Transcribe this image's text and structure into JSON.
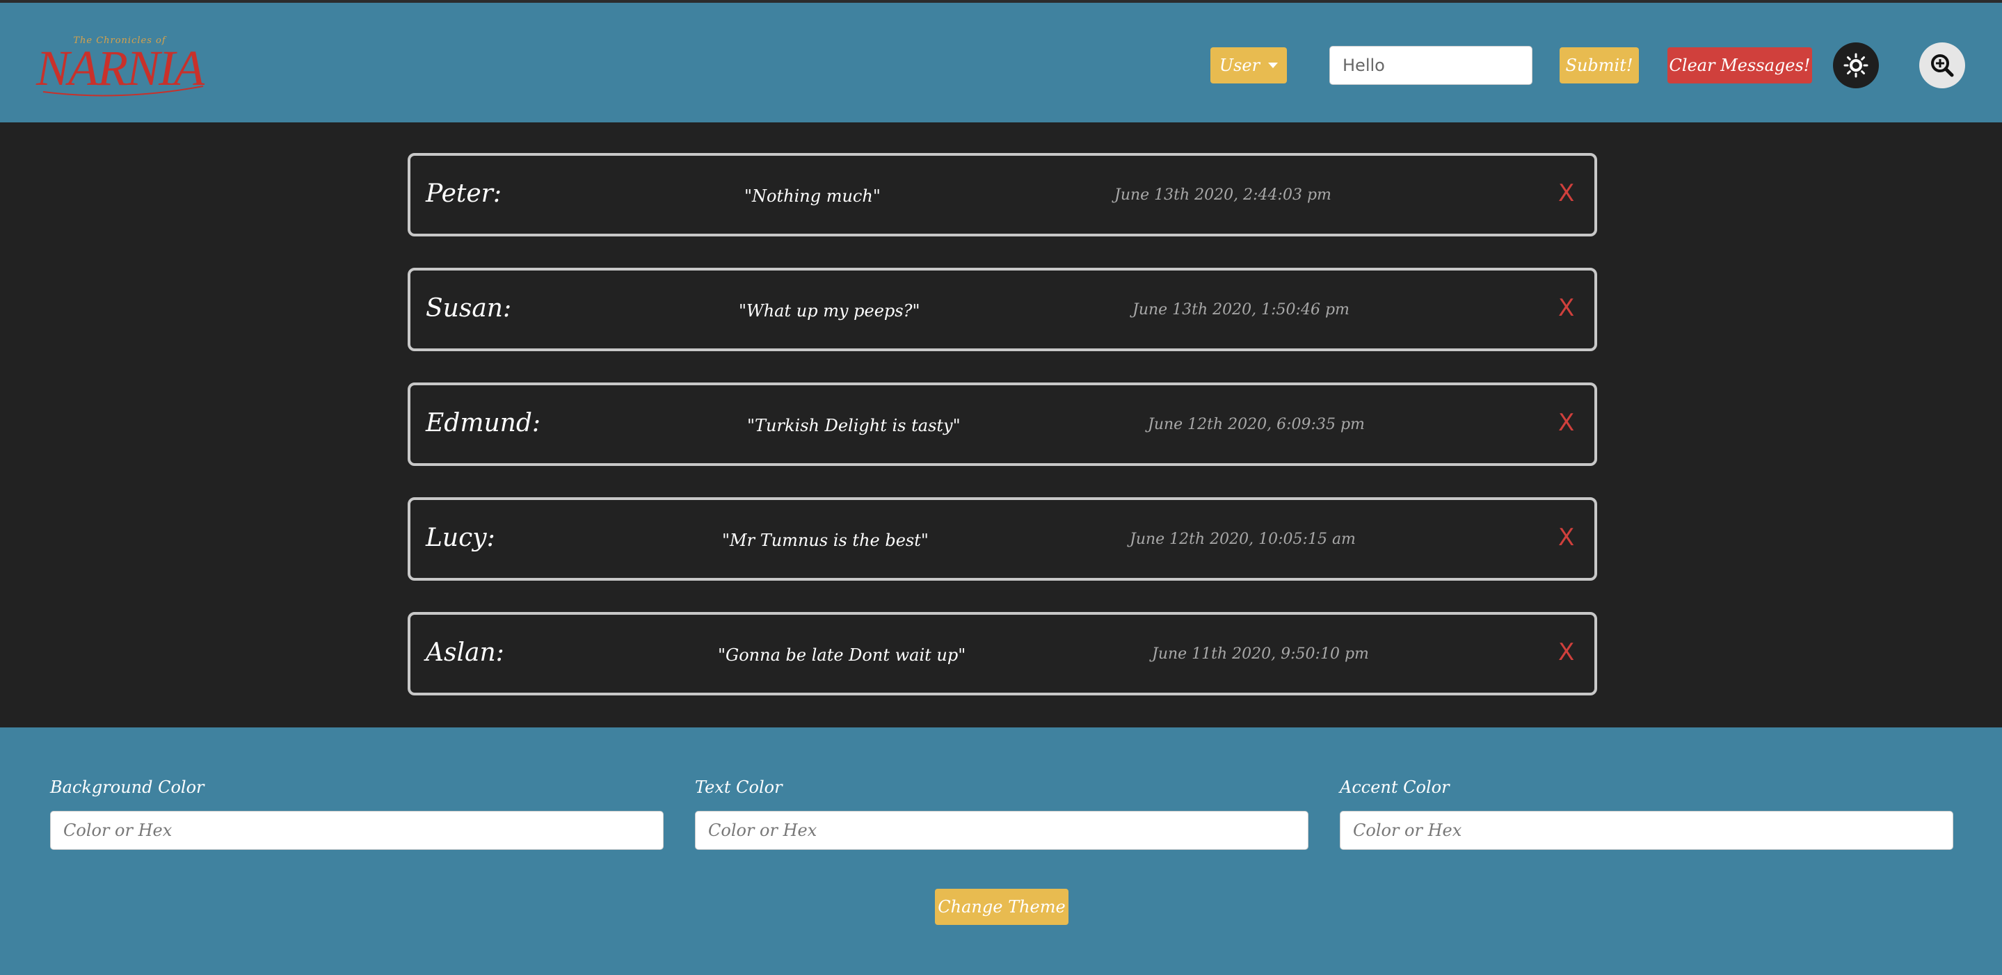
{
  "header": {
    "logo_alt": "The Chronicles of Narnia",
    "logo_top": "The Chronicles of",
    "logo_word": "NARNIA",
    "user_button": "User",
    "message_input_value": "Hello",
    "submit_label": "Submit!",
    "clear_label": "Clear Messages!"
  },
  "messages": [
    {
      "name": "Peter:",
      "text": "\"Nothing much\"",
      "time": "June 13th 2020, 2:44:03 pm",
      "delete": "X"
    },
    {
      "name": "Susan:",
      "text": "\"What up my peeps?\"",
      "time": "June 13th 2020, 1:50:46 pm",
      "delete": "X"
    },
    {
      "name": "Edmund:",
      "text": "\"Turkish Delight is tasty\"",
      "time": "June 12th 2020, 6:09:35 pm",
      "delete": "X"
    },
    {
      "name": "Lucy:",
      "text": "\"Mr Tumnus is the best\"",
      "time": "June 12th 2020, 10:05:15 am",
      "delete": "X"
    },
    {
      "name": "Aslan:",
      "text": "\"Gonna be late Dont wait up\"",
      "time": "June 11th 2020, 9:50:10 pm",
      "delete": "X"
    }
  ],
  "theme": {
    "background_label": "Background Color",
    "text_label": "Text Color",
    "accent_label": "Accent Color",
    "placeholder": "Color or Hex",
    "change_label": "Change Theme"
  },
  "colors": {
    "header_bg": "#40829f",
    "page_bg": "#222222",
    "accent_yellow": "#e8bb50",
    "danger_red": "#d0403c",
    "logo_red": "#c8312b",
    "logo_gold": "#d8a24a"
  },
  "icons": {
    "theme_toggle": "sun-icon",
    "zoom": "zoom-in-icon",
    "user_menu": "caret-down-icon"
  }
}
